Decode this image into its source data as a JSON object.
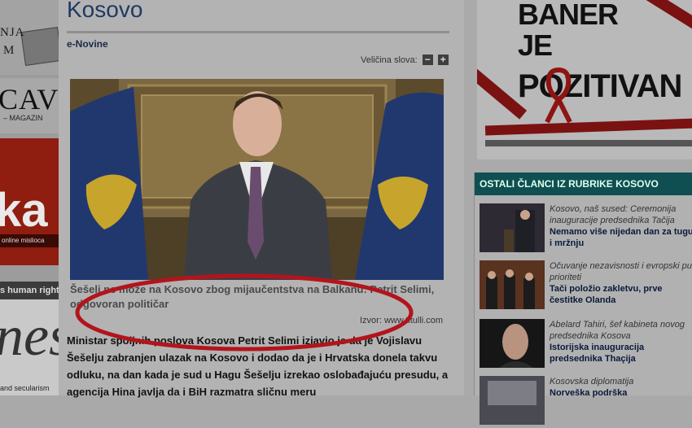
{
  "left_banners": {
    "b1_line1": "NJA",
    "b1_line2": "M",
    "b2_big": "CAV",
    "b2_small": "– MAGAZIN",
    "b3_big": "ka",
    "b3_small": "online mislioca",
    "b4_top": "s human rights",
    "b4_big": "nes",
    "b4_bottom": "and secularism"
  },
  "article": {
    "section_title": "Kosovo",
    "source": "e-Novine",
    "font_size_label": "Veličina slova:",
    "font_minus": "−",
    "font_plus": "+",
    "caption": "Šešelj ne može na Kosovo zbog mijaučentstva na Balkanu: Petrit Selimi, odgovoran političar",
    "credit": "Izvor: www.titulli.com",
    "lead": "Ministar spoljnih poslova Kosova Petrit Selimi izjavio je da je Vojislavu Šešelju zabranjen ulazak na Kosovo i dodao da je i Hrvatska donela takvu odluku, na dan kada je sud u Hagu Šešelju izrekao oslobađajuću presudu, a agencija Hina javlja da i BiH razmatra sličnu meru"
  },
  "banner": {
    "line1": "BANER",
    "line2": "JE",
    "line3": "POZITIVAN"
  },
  "others": {
    "heading": "OSTALI ČLANCI IZ RUBRIKE KOSOVO",
    "items": [
      {
        "kicker": "Kosovo, naš sused: Ceremonija inauguracije predsednika Tačija",
        "headline": "Nemamo više nijedan dan za tugu i mržnju"
      },
      {
        "kicker": "Očuvanje nezavisnosti i evropski put prioriteti",
        "headline": "Tači položio zakletvu, prve čestitke Olanda"
      },
      {
        "kicker": "Abelard Tahiri, šef kabineta novog predsednika Kosova",
        "headline": "Istorijska inauguracija predsednika Thaçija"
      },
      {
        "kicker": "Kosovska diplomatija",
        "headline": "Norveška podrška"
      }
    ]
  },
  "colors": {
    "page_title": "#1f3a63",
    "others_header_bg": "#0f4f52",
    "annotation_ellipse": "#b3141c",
    "ribbon": "#8e1313"
  }
}
